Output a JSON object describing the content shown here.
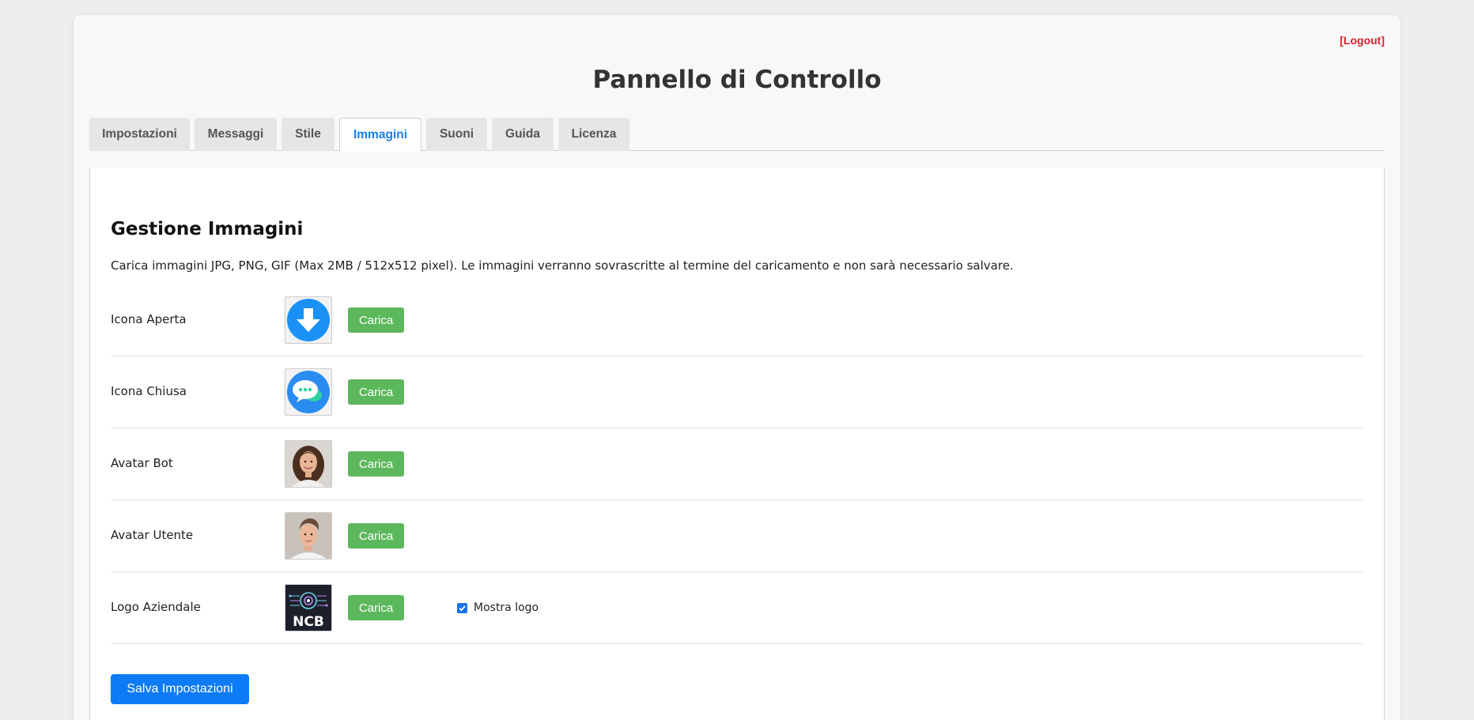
{
  "header": {
    "logout_label": "[Logout]",
    "title": "Pannello di Controllo"
  },
  "tabs": [
    {
      "label": "Impostazioni",
      "active": false
    },
    {
      "label": "Messaggi",
      "active": false
    },
    {
      "label": "Stile",
      "active": false
    },
    {
      "label": "Immagini",
      "active": true
    },
    {
      "label": "Suoni",
      "active": false
    },
    {
      "label": "Guida",
      "active": false
    },
    {
      "label": "Licenza",
      "active": false
    }
  ],
  "images": {
    "title": "Gestione Immagini",
    "description": "Carica immagini JPG, PNG, GIF (Max 2MB / 512x512 pixel). Le immagini verranno sovrascritte al termine del caricamento e non sarà necessario salvare.",
    "upload_label": "Carica",
    "rows": [
      {
        "label": "Icona Aperta",
        "icon": "download-arrow-icon"
      },
      {
        "label": "Icona Chiusa",
        "icon": "chat-bubble-icon"
      },
      {
        "label": "Avatar Bot",
        "icon": "woman-portrait"
      },
      {
        "label": "Avatar Utente",
        "icon": "man-portrait"
      },
      {
        "label": "Logo Aziendale",
        "icon": "ncb-logo"
      }
    ],
    "show_logo_label": "Mostra logo",
    "show_logo_checked": true,
    "ncb_logo_text": "NCB",
    "save_label": "Salva Impostazioni"
  },
  "colors": {
    "active_tab": "#1a7fe8",
    "upload_button": "#5cb85c",
    "save_button": "#0d7bf5",
    "logout": "#d9232e"
  }
}
